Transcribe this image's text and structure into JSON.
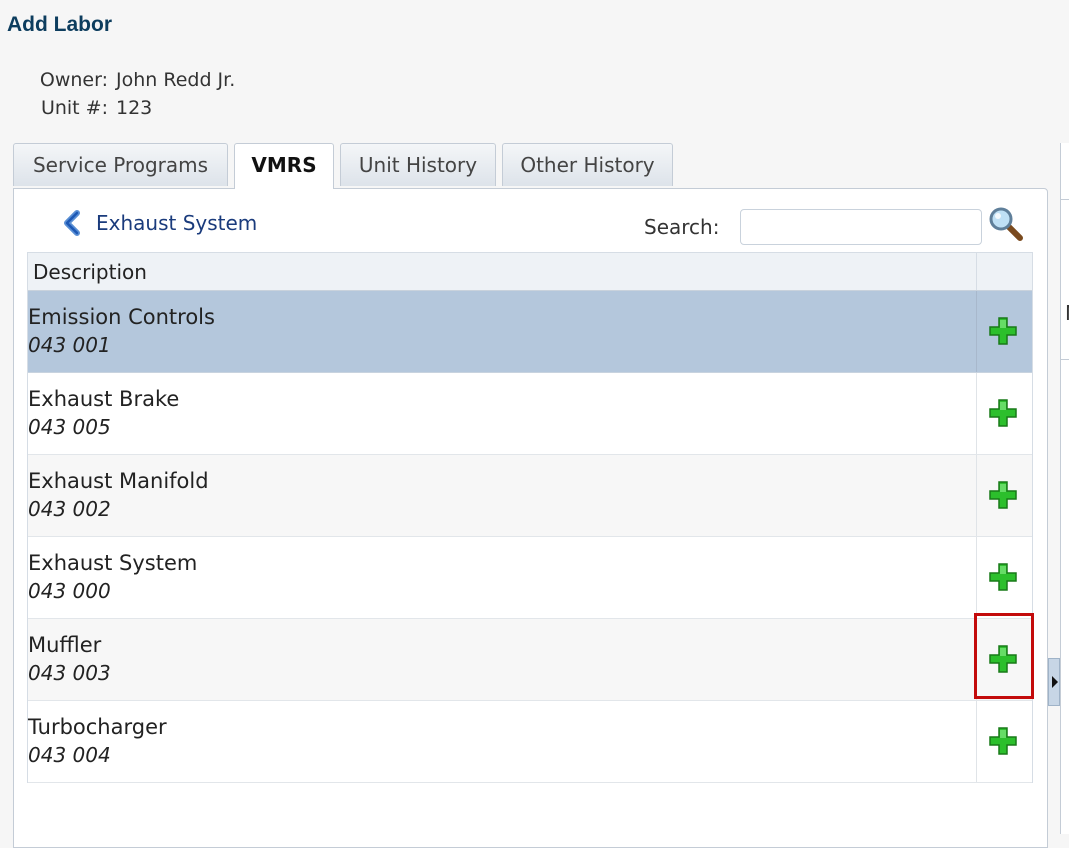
{
  "page": {
    "title": "Add Labor"
  },
  "info": {
    "owner_label": "Owner:",
    "owner_value": "John Redd Jr.",
    "unit_label": "Unit #:",
    "unit_value": "123"
  },
  "tabs": [
    {
      "label": "Service Programs",
      "active": false
    },
    {
      "label": "VMRS",
      "active": true
    },
    {
      "label": "Unit History",
      "active": false
    },
    {
      "label": "Other History",
      "active": false
    }
  ],
  "breadcrumb": {
    "label": "Exhaust System"
  },
  "search": {
    "label": "Search:",
    "value": "",
    "placeholder": ""
  },
  "table": {
    "header": "Description",
    "rows": [
      {
        "name": "Emission Controls",
        "code": "043 001",
        "selected": true
      },
      {
        "name": "Exhaust Brake",
        "code": "043 005",
        "selected": false
      },
      {
        "name": "Exhaust Manifold",
        "code": "043 002",
        "selected": false
      },
      {
        "name": "Exhaust System",
        "code": "043 000",
        "selected": false
      },
      {
        "name": "Muffler",
        "code": "043 003",
        "selected": false
      },
      {
        "name": "Turbocharger",
        "code": "043 004",
        "selected": false
      }
    ]
  },
  "right_panel": {
    "clipped_text": "N"
  },
  "colors": {
    "title": "#0d3d5e",
    "selected_row": "#b4c7dc",
    "add_icon": "#1fa81f",
    "highlight": "#c30b0b"
  },
  "icons": {
    "back": "chevron-left-icon",
    "search": "magnifier-icon",
    "add": "plus-icon"
  }
}
